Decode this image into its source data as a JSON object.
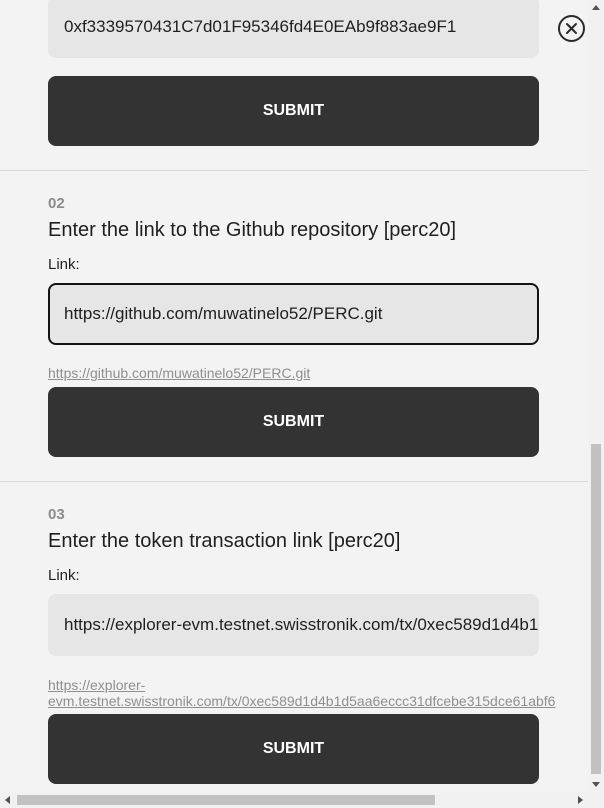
{
  "steps": [
    {
      "input_value": "0xf3339570431C7d01F95346fd4E0EAb9f883ae9F1",
      "submit_label": "SUBMIT"
    },
    {
      "number": "02",
      "title": "Enter the link to the Github repository [perc20]",
      "field_label": "Link:",
      "input_value": "https://github.com/muwatinelo52/PERC.git",
      "preview_link": "https://github.com/muwatinelo52/PERC.git",
      "submit_label": "SUBMIT"
    },
    {
      "number": "03",
      "title": "Enter the token transaction link [perc20]",
      "field_label": "Link:",
      "input_value": "https://explorer-evm.testnet.swisstronik.com/tx/0xec589d1d4b1d5aa6eccc31dfcebe315dce61abf6",
      "preview_link": "https://explorer-evm.testnet.swisstronik.com/tx/0xec589d1d4b1d5aa6eccc31dfcebe315dce61abf6",
      "submit_label": "SUBMIT"
    }
  ],
  "icons": {
    "close": "close-circle-icon"
  },
  "colors": {
    "background": "#f3f3f3",
    "button": "#333333",
    "field": "#e6e6e6",
    "muted_text": "#8b8b8b"
  }
}
